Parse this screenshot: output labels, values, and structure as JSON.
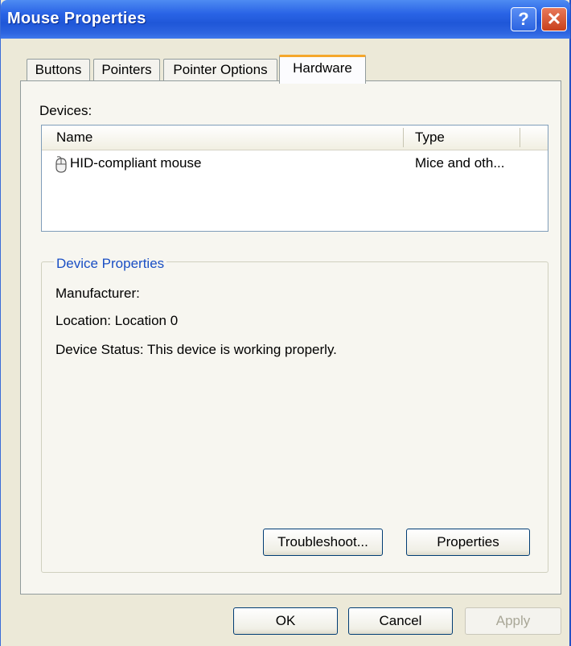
{
  "window": {
    "title": "Mouse Properties",
    "help_glyph": "?",
    "close_glyph": "✕"
  },
  "tabs": [
    {
      "label": "Buttons",
      "active": false
    },
    {
      "label": "Pointers",
      "active": false
    },
    {
      "label": "Pointer Options",
      "active": false
    },
    {
      "label": "Hardware",
      "active": true
    }
  ],
  "devices": {
    "label": "Devices:",
    "columns": [
      "Name",
      "Type"
    ],
    "rows": [
      {
        "name": "HID-compliant mouse",
        "type": "Mice and oth...",
        "icon": "mouse-icon"
      }
    ]
  },
  "device_properties": {
    "title": "Device Properties",
    "manufacturer": "Manufacturer:",
    "location": "Location: Location 0",
    "status": "Device Status: This device is working properly."
  },
  "buttons": {
    "troubleshoot": "Troubleshoot...",
    "properties": "Properties",
    "ok": "OK",
    "cancel": "Cancel",
    "apply": "Apply",
    "apply_enabled": false
  },
  "colors": {
    "titlebar": "#2a64e6",
    "active_tab_accent": "#f5a72c",
    "group_title": "#1a4fc4",
    "dialog_bg": "#ece9d8"
  }
}
